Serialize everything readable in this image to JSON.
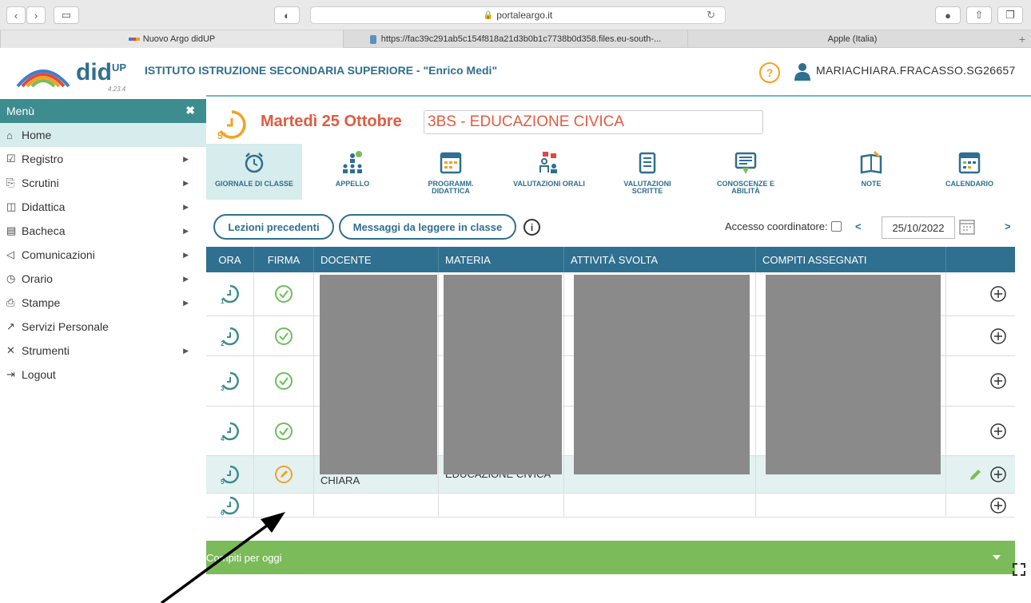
{
  "browser": {
    "url": "portaleargo.it",
    "tabs": [
      {
        "label": "Nuovo Argo didUP"
      },
      {
        "label": "https://fac39c291ab5c154f818a21d3b0b1c7738b0d358.files.eu-south-..."
      },
      {
        "label": "Apple (Italia)"
      }
    ]
  },
  "header": {
    "brand": "did",
    "brand_sup": "UP",
    "version": "4.23.4",
    "school": "ISTITUTO ISTRUZIONE SECONDARIA SUPERIORE - \"Enrico Medi\"",
    "help": "?",
    "user": "MARIACHIARA.FRACASSO.SG26657"
  },
  "sidebar": {
    "title": "Menù",
    "close": "✖",
    "items": [
      {
        "label": "Home",
        "icon": "home-icon",
        "submenu": false
      },
      {
        "label": "Registro",
        "icon": "calendar-check-icon",
        "submenu": true
      },
      {
        "label": "Scrutini",
        "icon": "doc-export-icon",
        "submenu": true
      },
      {
        "label": "Didattica",
        "icon": "book-open-icon",
        "submenu": true
      },
      {
        "label": "Bacheca",
        "icon": "board-icon",
        "submenu": true
      },
      {
        "label": "Comunicazioni",
        "icon": "megaphone-icon",
        "submenu": true
      },
      {
        "label": "Orario",
        "icon": "clock-icon",
        "submenu": true
      },
      {
        "label": "Stampe",
        "icon": "printer-icon",
        "submenu": true
      },
      {
        "label": "Servizi Personale",
        "icon": "external-link-icon",
        "submenu": false
      },
      {
        "label": "Strumenti",
        "icon": "tools-icon",
        "submenu": true
      },
      {
        "label": "Logout",
        "icon": "logout-icon",
        "submenu": false
      }
    ]
  },
  "main": {
    "day_title": "Martedì 25 Ottobre",
    "class_title": "3BS - EDUCAZIONE CIVICA",
    "tools": [
      {
        "label": "GIORNALE DI CLASSE",
        "label2": ""
      },
      {
        "label": "APPELLO",
        "label2": ""
      },
      {
        "label": "PROGRAMM.",
        "label2": "DIDATTICA"
      },
      {
        "label": "VALUTAZIONI ORALI",
        "label2": ""
      },
      {
        "label": "VALUTAZIONI",
        "label2": "SCRITTE"
      },
      {
        "label": "CONOSCENZE E",
        "label2": "ABILITÀ"
      },
      {
        "label": "NOTE",
        "label2": ""
      },
      {
        "label": "CALENDARIO",
        "label2": ""
      }
    ],
    "btn_prev": "Lezioni precedenti",
    "btn_msgs": "Messaggi da leggere in classe",
    "info": "i",
    "coord_label": "Accesso coordinatore:",
    "prev_arrow": "<",
    "next_arrow": ">",
    "date": "25/10/2022",
    "table": {
      "headers": [
        "ORA",
        "FIRMA",
        "DOCENTE",
        "MATERIA",
        "ATTIVITÀ SVOLTA",
        "COMPITI ASSEGNATI",
        ""
      ],
      "rows": [
        {
          "ora": "1",
          "signed": true,
          "docente": "",
          "materia": ""
        },
        {
          "ora": "2",
          "signed": true,
          "docente": "",
          "materia": ""
        },
        {
          "ora": "3",
          "signed": true,
          "docente": "",
          "materia": ""
        },
        {
          "ora": "4",
          "signed": true,
          "docente": "",
          "materia": ""
        },
        {
          "ora": "5",
          "signed": false,
          "docente": "FRACASSO MARIA CHIARA",
          "materia": "EDUCAZIONE CIVICA"
        },
        {
          "ora": "6",
          "signed": false,
          "docente": "",
          "materia": ""
        }
      ]
    },
    "compiti_bar": "Compiti per oggi"
  },
  "colors": {
    "accent": "#2f6f8f",
    "teal": "#3d8c8f",
    "orange": "#f2a223",
    "red": "#e05b42",
    "green_check": "#6bbf59",
    "bar_green": "#7cbb5a"
  }
}
